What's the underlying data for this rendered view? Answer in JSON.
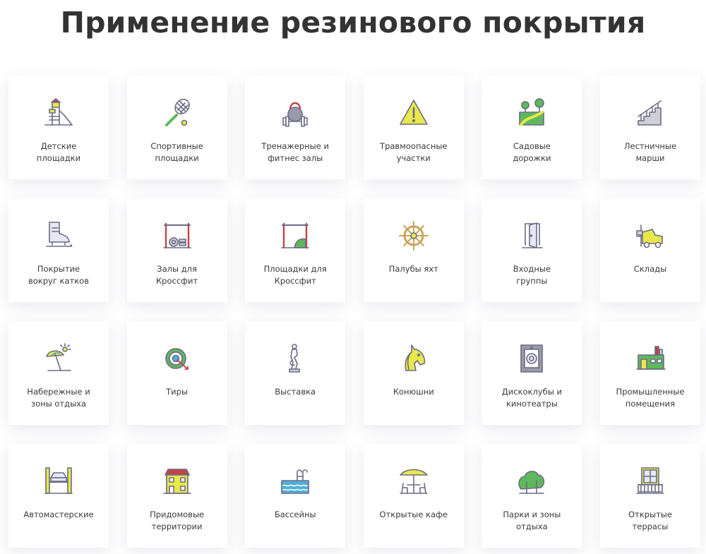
{
  "page": {
    "title": "Применение резинового покрытия"
  },
  "colors": {
    "stroke": "#6b6b86",
    "accent_yellow": "#e7e94a",
    "accent_green": "#5fb85c",
    "accent_red": "#c2434a",
    "accent_blue": "#4fb0d8"
  },
  "cards": [
    {
      "label": "Детские\nплощадки",
      "icon": "playground-icon"
    },
    {
      "label": "Спортивные\nплощадки",
      "icon": "tennis-racket-icon"
    },
    {
      "label": "Тренажерные и\nфитнес залы",
      "icon": "kettlebell-dumbbell-icon"
    },
    {
      "label": "Травмоопасные\nучастки",
      "icon": "warning-triangle-icon"
    },
    {
      "label": "Садовые\nдорожки",
      "icon": "garden-path-icon"
    },
    {
      "label": "Лестничные\nмарши",
      "icon": "stairs-icon"
    },
    {
      "label": "Покрытие\nвокруг катков",
      "icon": "ice-skate-icon"
    },
    {
      "label": "Залы для\nКроссфит",
      "icon": "crossfit-rig-icon"
    },
    {
      "label": "Площадки для\nКроссфит",
      "icon": "crossfit-outdoor-icon"
    },
    {
      "label": "Палубы яхт",
      "icon": "ship-wheel-icon"
    },
    {
      "label": "Входные\nгруппы",
      "icon": "door-icon"
    },
    {
      "label": "Склады",
      "icon": "forklift-icon"
    },
    {
      "label": "Набережные и\nзоны отдыха",
      "icon": "beach-umbrella-icon"
    },
    {
      "label": "Тиры",
      "icon": "target-icon"
    },
    {
      "label": "Выставка",
      "icon": "statue-icon"
    },
    {
      "label": "Конюшни",
      "icon": "horse-head-icon"
    },
    {
      "label": "Дискоклубы и\nкинотеатры",
      "icon": "speaker-icon"
    },
    {
      "label": "Промышленные\nпомещения",
      "icon": "factory-icon"
    },
    {
      "label": "Автомастерские",
      "icon": "car-lift-icon"
    },
    {
      "label": "Придомовые\nтерритории",
      "icon": "house-icon"
    },
    {
      "label": "Бассейны",
      "icon": "pool-icon"
    },
    {
      "label": "Открытые кафе",
      "icon": "cafe-table-icon"
    },
    {
      "label": "Парки и зоны\nотдыха",
      "icon": "park-trees-icon"
    },
    {
      "label": "Открытые\nтеррасы",
      "icon": "terrace-balcony-icon"
    }
  ]
}
